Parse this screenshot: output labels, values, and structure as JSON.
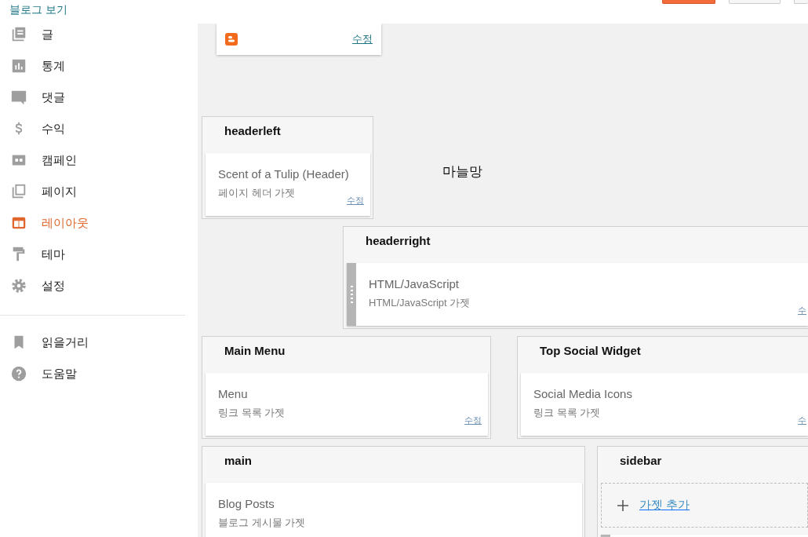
{
  "nav": {
    "view_blog": "블로그 보기",
    "items": [
      {
        "label": "글",
        "selected": false
      },
      {
        "label": "통계",
        "selected": false
      },
      {
        "label": "댓글",
        "selected": false
      },
      {
        "label": "수익",
        "selected": false
      },
      {
        "label": "캠페인",
        "selected": false
      },
      {
        "label": "페이지",
        "selected": false
      },
      {
        "label": "레이아웃",
        "selected": true
      },
      {
        "label": "테마",
        "selected": false
      },
      {
        "label": "설정",
        "selected": false
      }
    ],
    "secondary_items": [
      {
        "label": "읽을거리"
      },
      {
        "label": "도움말"
      }
    ]
  },
  "favicon_widget": {
    "edit": "수정"
  },
  "blog_title": "마늘망",
  "sections": [
    {
      "title": "headerleft",
      "widgets": [
        {
          "title": "Scent of a Tulip (Header)",
          "subtitle": "페이지 헤더 가젯",
          "edit": "수정",
          "draggable": false
        }
      ]
    },
    {
      "title": "headerright",
      "widgets": [
        {
          "title": "HTML/JavaScript",
          "subtitle": "HTML/JavaScript 가젯",
          "edit": "수",
          "draggable": true
        }
      ]
    },
    {
      "title": "Main Menu",
      "widgets": [
        {
          "title": "Menu",
          "subtitle": "링크 목록 가젯",
          "edit": "수정",
          "draggable": false
        }
      ]
    },
    {
      "title": "Top Social Widget",
      "widgets": [
        {
          "title": "Social Media Icons",
          "subtitle": "링크 목록 가젯",
          "edit": "수",
          "draggable": false
        }
      ]
    },
    {
      "title": "main",
      "widgets": [
        {
          "title": "Blog Posts",
          "subtitle": "블로그 게시물 가젯",
          "draggable": false
        }
      ]
    },
    {
      "title": "sidebar",
      "add_gadget": "가젯 추가",
      "widgets": [
        {
          "draggable": true
        }
      ]
    }
  ]
}
